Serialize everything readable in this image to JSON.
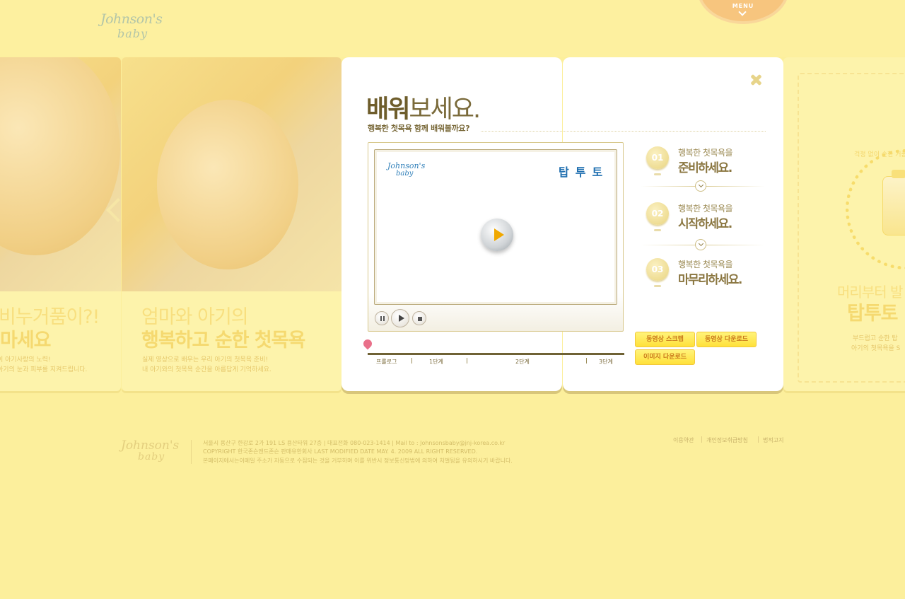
{
  "header": {
    "logo_line1": "Johnson's",
    "logo_line2": "baby",
    "menu_label": "MENU"
  },
  "left_panel": {
    "title_line1": "비누거품이?!",
    "title_line2": "마세요",
    "desc_line1": "이 아기사랑의 노력!",
    "desc_line2": "아기의 눈과 피부를 지켜드립니다."
  },
  "mid_panel": {
    "title_line1": "엄마와 아기의",
    "title_line2": "행복하고 순한 첫목욕",
    "desc_line1": "실제 영상으로 배우는 우리 아기의 첫목욕 준비!",
    "desc_line2": "내 아기와의 첫목욕 순간을 아름답게 기억하세요."
  },
  "right_panel": {
    "circle_text": "걱정 없이 순한 거품으로 순하고",
    "title_line1": "머리부터 발",
    "title_line2": "탑투토",
    "desc_line1": "부드럽고 순한 탑",
    "desc_line2": "아기의 첫목욕을 S"
  },
  "modal": {
    "title_bold": "배워",
    "title_rest": "보세요.",
    "subtitle": "행복한 첫목욕 함께 배워볼까요?",
    "player": {
      "logo_line1": "Johnson's",
      "logo_line2": "baby",
      "brand_text": "탑투토"
    },
    "timeline": [
      "프롤로그",
      "1단계",
      "2단계",
      "3단계"
    ],
    "steps": [
      {
        "num": "01",
        "small": "행복한 첫목욕을",
        "big": "준비하세요."
      },
      {
        "num": "02",
        "small": "행복한 첫목욕을",
        "big": "시작하세요."
      },
      {
        "num": "03",
        "small": "행복한 첫목욕을",
        "big": "마무리하세요."
      }
    ],
    "buttons": {
      "scrap": "동영상 스크랩",
      "video_download": "동영상 다운로드",
      "image_download": "이미지 다운로드"
    }
  },
  "footer": {
    "logo_line1": "Johnson's",
    "logo_line2": "baby",
    "address": "서울시 용산구 한강로 2가 191 LS 용산타워 27층  |  대표전화 080-023-1414  |  Mail to : Johnsonsbaby@jnj-korea.co.kr",
    "copyright": "COPYRIGHT 한국존슨앤드존슨 판매유한회사  LAST MODIFIED DATE MAY. 4. 2009 ALL RIGHT RESERVED.",
    "notice": "본페이지에서는이메일 주소가 자동으로 수집되는 것을 거부하며 이를 위반시 정보통신망법에 의하여 처벌됨을 유의하시기 바랍니다.",
    "links": [
      "이용약관",
      "개인정보취급방침",
      "법적고지"
    ]
  }
}
